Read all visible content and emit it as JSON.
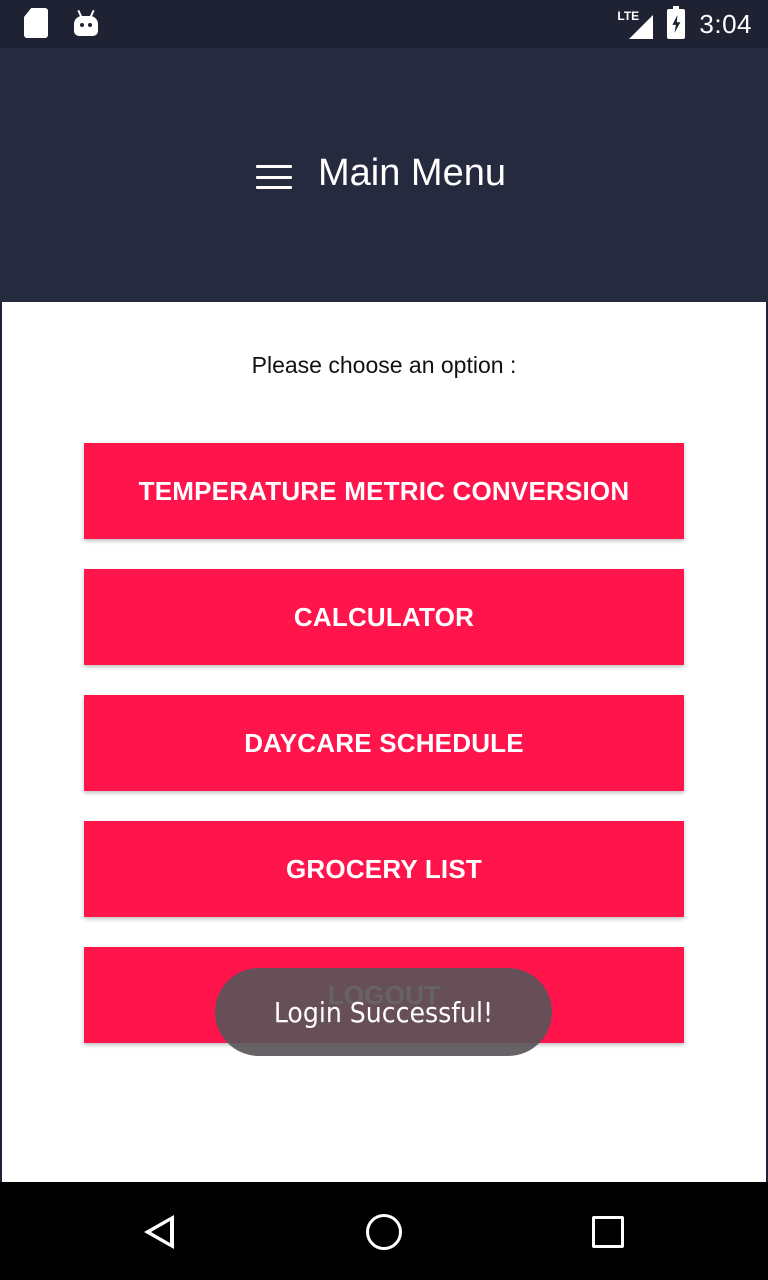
{
  "status_bar": {
    "network": "LTE",
    "time": "3:04",
    "icons": [
      "sd-card-icon",
      "android-debug-icon",
      "lte-signal-icon",
      "battery-charging-icon"
    ]
  },
  "app_bar": {
    "title": "Main Menu",
    "menu_icon": "hamburger-menu-icon",
    "background": "#252a3e"
  },
  "main": {
    "prompt": "Please choose an option :",
    "buttons": [
      {
        "label": "TEMPERATURE METRIC CONVERSION"
      },
      {
        "label": "CALCULATOR"
      },
      {
        "label": "DAYCARE SCHEDULE"
      },
      {
        "label": "GROCERY LIST"
      },
      {
        "label": "LOGOUT"
      }
    ],
    "button_color": "#ff144c"
  },
  "toast": {
    "message": "Login Successful!"
  },
  "nav_bar": {
    "icons": [
      "back-icon",
      "home-icon",
      "recents-icon"
    ]
  }
}
